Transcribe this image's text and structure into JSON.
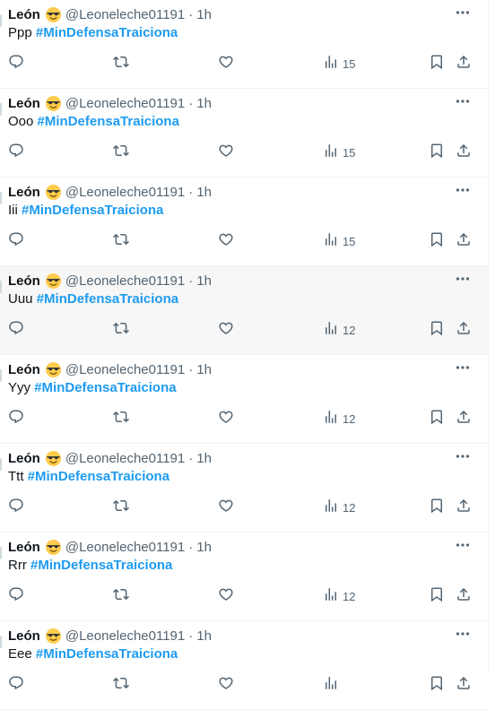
{
  "tweets": [
    {
      "name": "León",
      "handle": "@Leoneleche01191",
      "dot": "·",
      "time": "1h",
      "text": "Ppp",
      "hashtag": "#MinDefensaTraiciona",
      "views": "15"
    },
    {
      "name": "León",
      "handle": "@Leoneleche01191",
      "dot": "·",
      "time": "1h",
      "text": "Ooo",
      "hashtag": "#MinDefensaTraiciona",
      "views": "15"
    },
    {
      "name": "León",
      "handle": "@Leoneleche01191",
      "dot": "·",
      "time": "1h",
      "text": "Iii",
      "hashtag": "#MinDefensaTraiciona",
      "views": "15"
    },
    {
      "name": "León",
      "handle": "@Leoneleche01191",
      "dot": "·",
      "time": "1h",
      "text": "Uuu",
      "hashtag": "#MinDefensaTraiciona",
      "views": "12",
      "highlighted": true
    },
    {
      "name": "León",
      "handle": "@Leoneleche01191",
      "dot": "·",
      "time": "1h",
      "text": "Yyy",
      "hashtag": "#MinDefensaTraiciona",
      "views": "12"
    },
    {
      "name": "León",
      "handle": "@Leoneleche01191",
      "dot": "·",
      "time": "1h",
      "text": "Ttt",
      "hashtag": "#MinDefensaTraiciona",
      "views": "12"
    },
    {
      "name": "León",
      "handle": "@Leoneleche01191",
      "dot": "·",
      "time": "1h",
      "text": "Rrr",
      "hashtag": "#MinDefensaTraiciona",
      "views": "12"
    },
    {
      "name": "León",
      "handle": "@Leoneleche01191",
      "dot": "·",
      "time": "1h",
      "text": "Eee",
      "hashtag": "#MinDefensaTraiciona",
      "views": null
    }
  ],
  "icons": {
    "emoji": "sunglasses-emoji-icon",
    "more": "more-dots-icon",
    "reply": "reply-icon",
    "retweet": "retweet-icon",
    "like": "heart-icon",
    "views": "views-bar-chart-icon",
    "bookmark": "bookmark-icon",
    "share": "share-icon"
  },
  "colors": {
    "hashtag": "#1d9bf0",
    "muted": "#536471",
    "text": "#0f1419",
    "divider": "#eff3f4",
    "highlight": "#f7f7f7"
  }
}
